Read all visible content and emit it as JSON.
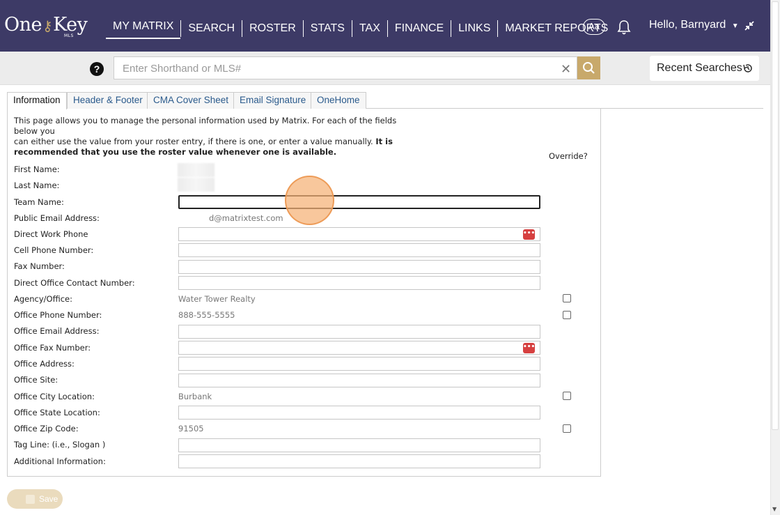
{
  "brand": {
    "logo_left": "One",
    "logo_right": "Key",
    "logo_sub": "MLS"
  },
  "nav": {
    "items": [
      {
        "label": "MY MATRIX",
        "active": true
      },
      {
        "label": "SEARCH"
      },
      {
        "label": "ROSTER"
      },
      {
        "label": "STATS"
      },
      {
        "label": "TAX"
      },
      {
        "label": "FINANCE"
      },
      {
        "label": "LINKS"
      },
      {
        "label": "MARKET REPORTS"
      }
    ],
    "font_button": "Aa",
    "greeting": "Hello, Barnyard"
  },
  "search": {
    "placeholder": "Enter Shorthand or MLS#",
    "clear_glyph": "✕",
    "recent_label": "Recent Searches"
  },
  "tabs": [
    "Information",
    "Header & Footer",
    "CMA Cover Sheet",
    "Email Signature",
    "OneHome"
  ],
  "intro": {
    "line1": "This page allows you to manage the personal information used by Matrix. For each of the fields below you",
    "line2": "can either use the value from your roster entry, if there is one, or enter a value manually.",
    "bold": "It is recommended that you use the roster value whenever one is available."
  },
  "override_label": "Override?",
  "form": {
    "first_name": "First Name:",
    "last_name": "Last Name:",
    "team_name": "Team Name:",
    "public_email": "Public Email Address:",
    "public_email_value": "d@matrixtest.com",
    "direct_work_phone": "Direct Work Phone",
    "cell_phone": "Cell Phone Number:",
    "fax": "Fax Number:",
    "direct_office_contact": "Direct Office Contact Number:",
    "agency_office": "Agency/Office:",
    "agency_office_value": "Water Tower Realty",
    "office_phone": "Office Phone Number:",
    "office_phone_value": "888-555-5555",
    "office_email": "Office Email Address:",
    "office_fax": "Office Fax Number:",
    "office_address": "Office Address:",
    "office_site": "Office Site:",
    "office_city": "Office City Location:",
    "office_city_value": "Burbank",
    "office_state": "Office State Location:",
    "office_zip": "Office Zip Code:",
    "office_zip_value": "91505",
    "tag_line": "Tag Line: (i.e., Slogan )",
    "additional_info": "Additional Information:"
  },
  "pwd_glyph": "•••",
  "save_label": "Save",
  "colors": {
    "nav_bg": "#3d3a66",
    "accent_gold": "#c8a96b",
    "link_blue": "#2a5a8c",
    "pwd_red": "#d64040"
  }
}
